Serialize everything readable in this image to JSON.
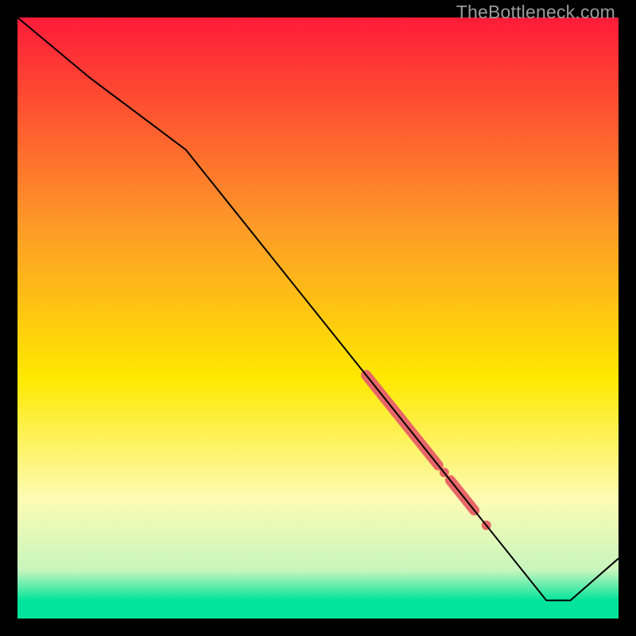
{
  "watermark": "TheBottleneck.com",
  "palette": {
    "top": "#fe1b39",
    "mid_upper": "#fe9b27",
    "mid": "#fee800",
    "mid_lower": "#fdfcb3",
    "green_light": "#c7f5bd",
    "green": "#02e49b",
    "line": "#000000",
    "marker": "#e86667",
    "frame_bg": "#000000"
  },
  "chart_data": {
    "type": "line",
    "title": "",
    "xlabel": "",
    "ylabel": "",
    "xlim": [
      0,
      100
    ],
    "ylim": [
      0,
      100
    ],
    "x": [
      0,
      12,
      28,
      88,
      92,
      100
    ],
    "y": [
      100,
      90,
      78,
      3,
      3,
      10
    ],
    "series": [
      {
        "name": "curve",
        "x": [
          0,
          12,
          28,
          88,
          92,
          100
        ],
        "y": [
          100,
          90,
          78,
          3,
          3,
          10
        ]
      }
    ],
    "highlight_segments": [
      {
        "x0": 58,
        "y0": 40.5,
        "x1": 70,
        "y1": 25.5,
        "thick": true
      },
      {
        "x0": 72,
        "y0": 23.0,
        "x1": 76,
        "y1": 18.0,
        "thick": true
      },
      {
        "x0": 71,
        "y0": 24.3,
        "x1": 71,
        "y1": 24.3,
        "thick": false
      },
      {
        "x0": 78,
        "y0": 15.5,
        "x1": 78,
        "y1": 15.5,
        "thick": false
      }
    ],
    "gradient_stops_pct": [
      {
        "offset": 0,
        "color": "#fe1b39"
      },
      {
        "offset": 35,
        "color": "#fe9b27"
      },
      {
        "offset": 60,
        "color": "#fee800"
      },
      {
        "offset": 80,
        "color": "#fdfcb3"
      },
      {
        "offset": 92,
        "color": "#c7f5bd"
      },
      {
        "offset": 97,
        "color": "#02e49b"
      },
      {
        "offset": 100,
        "color": "#02e49b"
      }
    ]
  }
}
